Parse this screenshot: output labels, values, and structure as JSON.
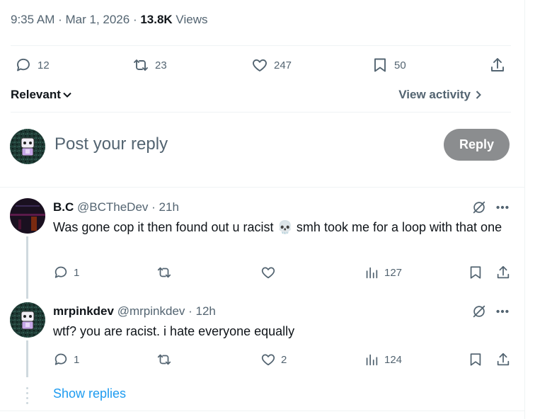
{
  "tweet_meta": {
    "time": "9:35 AM",
    "sep1": " · ",
    "date": "Mar 1, 2026",
    "sep2": " · ",
    "views_count": "13.8K",
    "views_label": " Views"
  },
  "actions": {
    "replies": "12",
    "reposts": "23",
    "likes": "247",
    "bookmarks": "50"
  },
  "sort": {
    "label": "Relevant",
    "view_activity": "View activity"
  },
  "composer": {
    "placeholder": "Post your reply",
    "button": "Reply"
  },
  "replies": [
    {
      "name": "B.C",
      "handle": "@BCTheDev",
      "dot": " · ",
      "time": "21h",
      "text": "Was gone cop it then found out u racist 💀 smh took me for a loop with that one",
      "reply_count": "1",
      "repost_count": "",
      "like_count": "",
      "view_count": "127"
    },
    {
      "name": "mrpinkdev",
      "handle": "@mrpinkdev",
      "dot": " · ",
      "time": "12h",
      "text": "wtf? you are racist. i hate everyone equally",
      "reply_count": "1",
      "repost_count": "",
      "like_count": "2",
      "view_count": "124"
    }
  ],
  "show_replies": "Show replies",
  "colors": {
    "link": "#1d9bf0",
    "muted": "#536471",
    "text": "#0f1419",
    "reply_button_bg": "#8b8d8f"
  }
}
